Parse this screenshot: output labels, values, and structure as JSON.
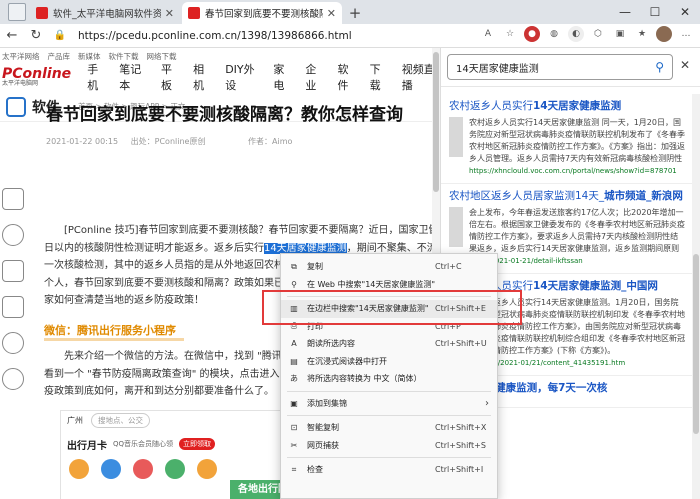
{
  "tabs": [
    {
      "title": "软件_太平洋电脑网软件资讯频道",
      "active": false
    },
    {
      "title": "春节回家到底要不要测核酸隔离",
      "active": true
    }
  ],
  "address": {
    "url": "https://pcedu.pconline.com.cn/1398/13986866.html"
  },
  "site": {
    "topnav": [
      "太平洋网络",
      "产品库",
      "新媒体",
      "软件下载",
      "网络下载"
    ],
    "logo": "PConline",
    "logo_sub": "太平洋电脑网",
    "mainnav": [
      "手机",
      "笔记本",
      "平板",
      "相机",
      "DIY外设",
      "家电",
      "企业",
      "软件",
      "下载",
      "视频直播"
    ],
    "section_title": "软件",
    "breadcrumb": "首页 > 软件 > 趣玩APP > 正文"
  },
  "article": {
    "headline": "春节回家到底要不要测核酸隔离？教你怎样查询",
    "date": "2021-01-22 00:15",
    "source": "出处：PConline原创",
    "author": "作者：Aimo",
    "p1_a": "[PConline 技巧]春节回家到底要不要测核酸？春节回家要不要隔离？近日，国家卫健委首",
    "p1_b_pre": "日以内的核酸阴性检测证明才能返乡。返乡后实行",
    "p1_b_hl": "14天居家健康监测",
    "p1_b_post": "，期间不聚集、不流动",
    "p1_c": "一次核酸检测，其中的返乡人员指的是从外地返回农村地区",
    "p1_d": "个人，春节回家到底要不要测核酸和隔离？政策如果已经",
    "p1_e": "家如何查清楚当地的返乡防疫政策！",
    "subhead": "微信：腾讯出行服务小程序",
    "p2_a": "先来介绍一个微信的方法。在微信中，找到 \"腾讯出行",
    "p2_b": "看到一个 \"春节防疫隔离政策查询\" 的模块，点击进入，找到",
    "p2_c": "疫政策到底如何，离开和到达分别都要准备什么了。",
    "embedded": {
      "city": "广州",
      "search": "搜地点、公交",
      "brand": "出行月卡",
      "tagline": "QQ音乐会员随心领",
      "badge": "立即领取"
    },
    "banner": "各地出行防疫政策查询"
  },
  "context_menu": {
    "items": [
      {
        "icon": "copy-icon",
        "label": "复制",
        "key": "Ctrl+C"
      },
      {
        "icon": "search-web-icon",
        "label": "在 Web 中搜索\"14天居家健康监测\"",
        "key": ""
      },
      {
        "icon": "sidebar-icon",
        "label": "在边栏中搜索\"14天居家健康监测\"",
        "key": "Ctrl+Shift+E"
      },
      {
        "icon": "print-icon",
        "label": "打印",
        "key": "Ctrl+P"
      },
      {
        "icon": "read-aloud-icon",
        "label": "朗读所选内容",
        "key": "Ctrl+Shift+U"
      },
      {
        "icon": "immersive-reader-icon",
        "label": "在沉浸式阅读器中打开",
        "key": ""
      },
      {
        "icon": "translate-icon",
        "label": "将所选内容转换为 中文（简体）",
        "key": ""
      },
      {
        "icon": "collections-icon",
        "label": "添加到集锦",
        "key": ""
      },
      {
        "icon": "smart-copy-icon",
        "label": "智能复制",
        "key": "Ctrl+Shift+X"
      },
      {
        "icon": "web-capture-icon",
        "label": "网页捕获",
        "key": "Ctrl+Shift+S"
      },
      {
        "icon": "inspect-icon",
        "label": "检查",
        "key": "Ctrl+Shift+I"
      }
    ]
  },
  "sidebar": {
    "query": "14天居家健康监测",
    "results": [
      {
        "title_pre": "农村返乡人员实行",
        "title_bold": "14天居家健康监测",
        "snippet": "农村返乡人员实行14天居家健康监测 同一天，1月20日，国务院应对新型冠状病毒肺炎疫情联防联控机制发布了《冬春季农村地区新冠肺炎疫情防控工作方案》。《方案》指出：加强返乡人员管理。返乡人员需持7天内有效新冠病毒核酸检测阴性结果返乡，返乡后实行14天居家健康监测...",
        "url": "https://xhnclould.voc.com.cn/portal/news/show?id=878701"
      },
      {
        "title_pre": "农村地区返乡人员居家监测14天_",
        "title_bold": "城市频道_新浪网",
        "snippet": "会上发布，今年春运发送旅客约17亿人次；比2020年增加一倍左右。根据国家卫健委发布的《冬春季农村地区新冠肺炎疫情防控工作方案》，要求返乡人员需持7天内核酸检测阴性结果返乡，返乡后实行14天居家健康监测，返乡监测期间原则上不得聚集、不流动...",
        "url": "fccdh/2021-01-21/detail-ikftssan"
      },
      {
        "title_pre": "农村返乡人员实行",
        "title_bold": "14天居家健康监测_中国网",
        "snippet": "农民工返乡人员实行14天居家健康监测。1月20日，国务院应对新型冠状病毒肺炎疫情联防联控机制印发《冬春季农村地区新冠肺炎疫情防控工作方案》，由国务院应对新型冠状病毒感染肺炎疫情联防联控机制综合组印发《冬春季农村地区新冠肺炎疫情防控工作方案》(下称《方案》)。",
        "url": "cn/news/2021-01/21/content_41435191.htm"
      },
      {
        "title_pre": "",
        "title_bold": "14天居家健康监测，每7天一次核",
        "snippet": "",
        "url": ""
      }
    ]
  }
}
